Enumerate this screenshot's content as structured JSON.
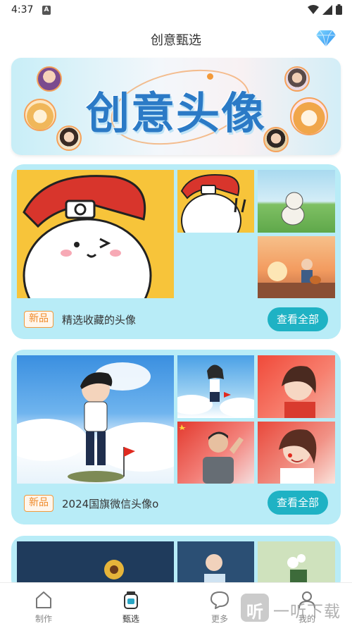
{
  "status_bar": {
    "time": "4:37",
    "sim_label": "A"
  },
  "header": {
    "title": "创意甄选",
    "vip_icon": "diamond-icon"
  },
  "banner": {
    "title": "创意头像"
  },
  "cards": [
    {
      "badge": "新品",
      "title": "精选收藏的头像",
      "button": "查看全部"
    },
    {
      "badge": "新品",
      "title": "2024国旗微信头像o",
      "button": "查看全部"
    }
  ],
  "bottom_nav": [
    {
      "label": "制作",
      "icon": "home-icon",
      "active": false
    },
    {
      "label": "甄选",
      "icon": "jar-icon",
      "active": true
    },
    {
      "label": "更多",
      "icon": "chat-bubble-icon",
      "active": false
    },
    {
      "label": "我的",
      "icon": "user-icon",
      "active": false
    }
  ],
  "watermark": {
    "logo": "听",
    "text": "一听下载"
  },
  "colors": {
    "accent": "#1fb2c4",
    "card_bg": "#b8ecf7",
    "badge": "#ef8a2a",
    "banner_title": "#2b7ac6"
  }
}
